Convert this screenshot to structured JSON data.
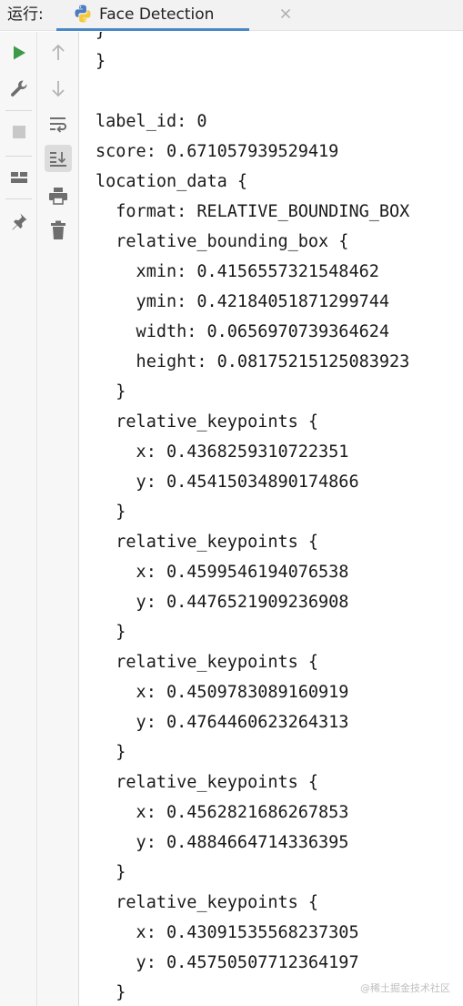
{
  "topbar": {
    "run_label": "运行:",
    "tab_title": "Face Detection"
  },
  "icons": {
    "tab_icon": "python-icon",
    "tab_close": "close-icon",
    "run": "run-icon",
    "settings": "wrench-icon",
    "stop": "stop-icon",
    "layout": "layout-icon",
    "pin": "pin-icon",
    "up": "arrow-up-icon",
    "down": "arrow-down-icon",
    "wrap": "soft-wrap-icon",
    "scroll_end": "scroll-to-end-icon",
    "print": "print-icon",
    "trash": "trash-icon"
  },
  "colors": {
    "run_green": "#3d9a48",
    "tab_accent": "#4a88c7",
    "icon_gray": "#6e6e6e",
    "disabled_gray": "#b4b4b4"
  },
  "console": {
    "lines": [
      "}",
      "}",
      "",
      "label_id: 0",
      "score: 0.671057939529419",
      "location_data {",
      "  format: RELATIVE_BOUNDING_BOX",
      "  relative_bounding_box {",
      "    xmin: 0.4156557321548462",
      "    ymin: 0.42184051871299744",
      "    width: 0.0656970739364624",
      "    height: 0.08175215125083923",
      "  }",
      "  relative_keypoints {",
      "    x: 0.4368259310722351",
      "    y: 0.45415034890174866",
      "  }",
      "  relative_keypoints {",
      "    x: 0.4599546194076538",
      "    y: 0.4476521909236908",
      "  }",
      "  relative_keypoints {",
      "    x: 0.4509783089160919",
      "    y: 0.4764460623264313",
      "  }",
      "  relative_keypoints {",
      "    x: 0.4562821686267853",
      "    y: 0.4884664714336395",
      "  }",
      "  relative_keypoints {",
      "    x: 0.43091535568237305",
      "    y: 0.45750507712364197",
      "  }"
    ]
  },
  "watermark": "@稀土掘金技术社区"
}
